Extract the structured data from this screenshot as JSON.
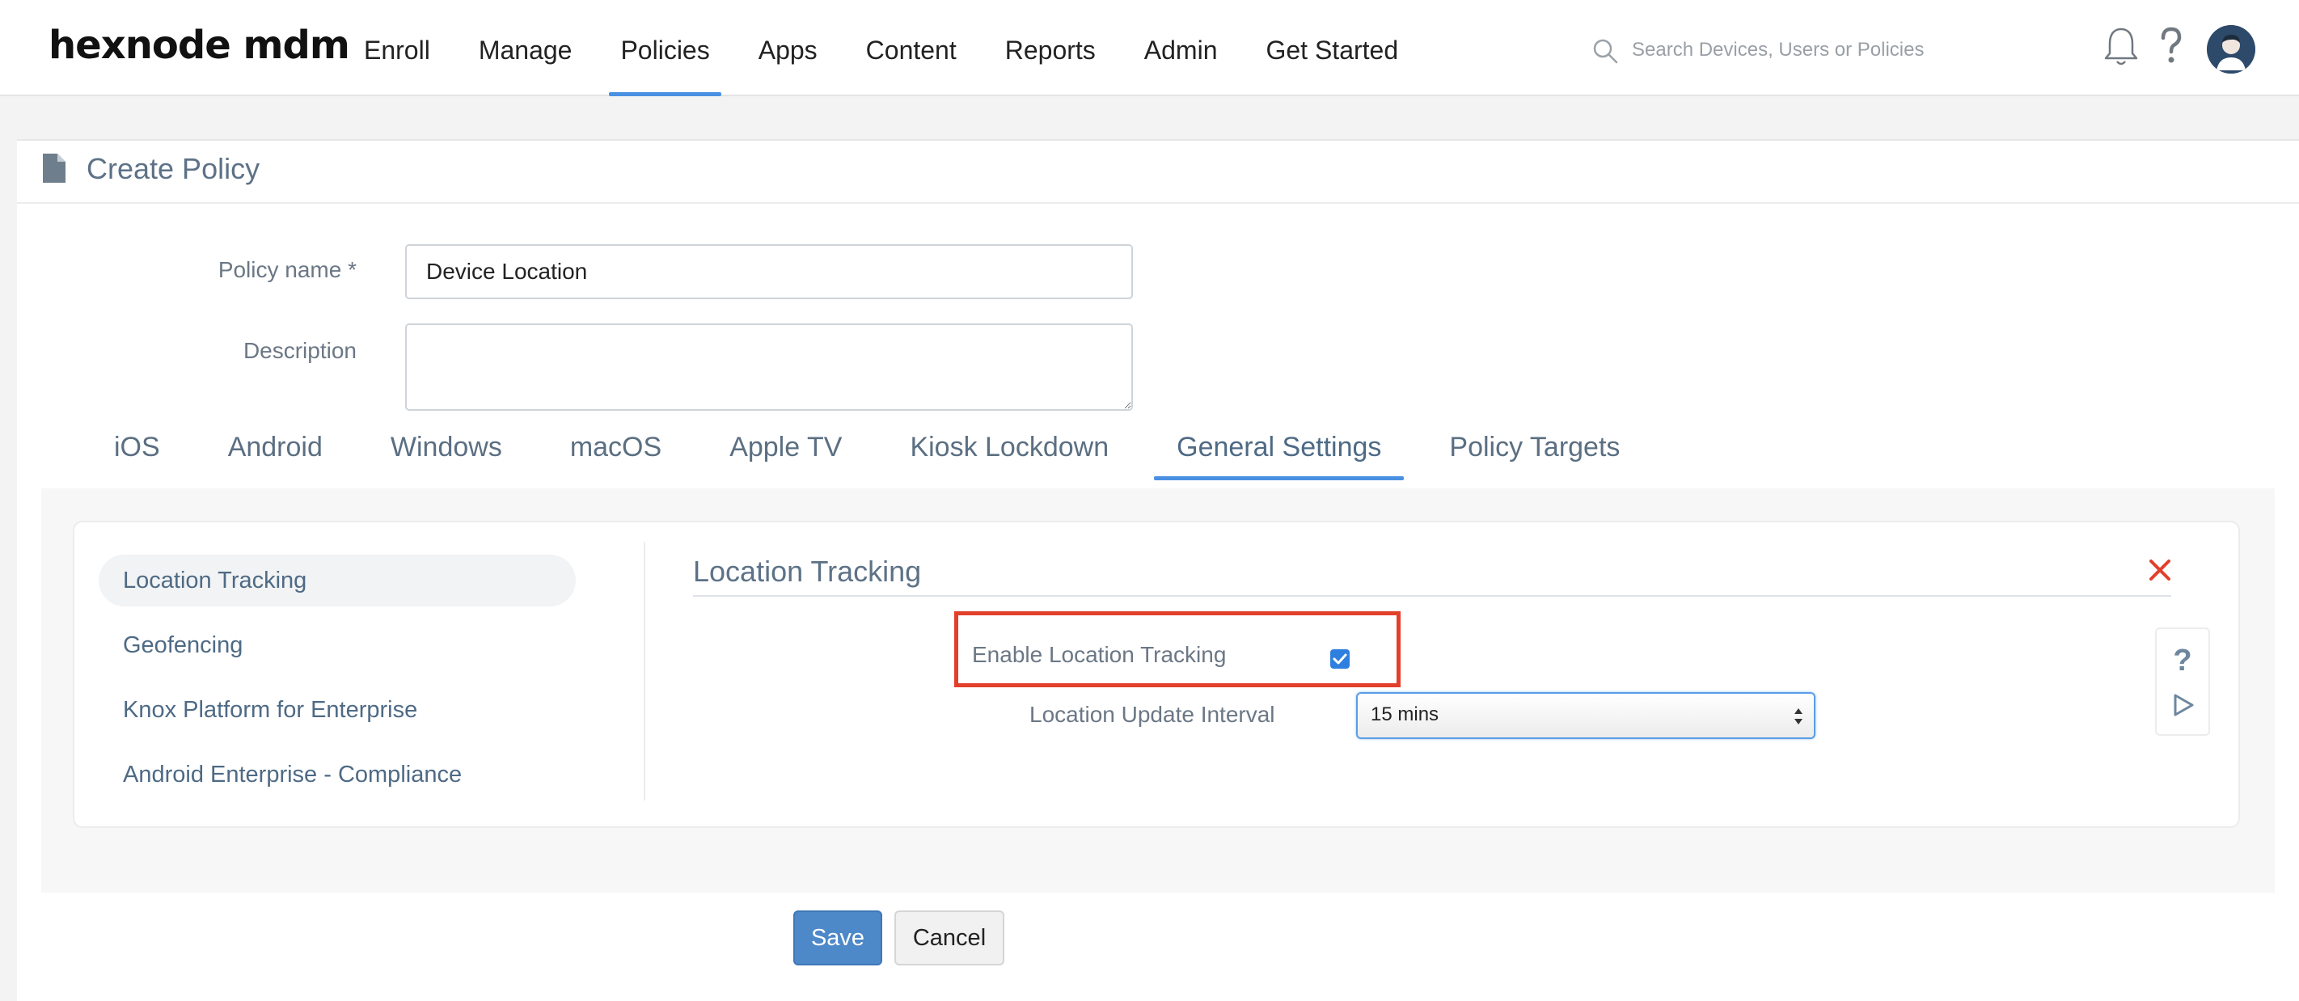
{
  "header": {
    "logo": "hexnode mdm",
    "nav": [
      {
        "label": "Enroll",
        "active": false
      },
      {
        "label": "Manage",
        "active": false
      },
      {
        "label": "Policies",
        "active": true
      },
      {
        "label": "Apps",
        "active": false
      },
      {
        "label": "Content",
        "active": false
      },
      {
        "label": "Reports",
        "active": false
      },
      {
        "label": "Admin",
        "active": false
      },
      {
        "label": "Get Started",
        "active": false
      }
    ],
    "search": {
      "placeholder": "Search Devices, Users or Policies",
      "value": "",
      "icon": "search-icon"
    },
    "icons": [
      "bell-icon",
      "help-icon",
      "user-avatar"
    ]
  },
  "page": {
    "title": "Create Policy",
    "icon": "document-icon"
  },
  "form": {
    "policy_name_label": "Policy name *",
    "policy_name_value": "Device Location",
    "description_label": "Description",
    "description_value": ""
  },
  "tabs": [
    {
      "label": "iOS",
      "active": false
    },
    {
      "label": "Android",
      "active": false
    },
    {
      "label": "Windows",
      "active": false
    },
    {
      "label": "macOS",
      "active": false
    },
    {
      "label": "Apple TV",
      "active": false
    },
    {
      "label": "Kiosk Lockdown",
      "active": false
    },
    {
      "label": "General Settings",
      "active": true
    },
    {
      "label": "Policy Targets",
      "active": false
    }
  ],
  "sidebar": {
    "items": [
      {
        "label": "Location Tracking",
        "active": true
      },
      {
        "label": "Geofencing",
        "active": false
      },
      {
        "label": "Knox Platform for Enterprise",
        "active": false
      },
      {
        "label": "Android Enterprise - Compliance",
        "active": false
      }
    ]
  },
  "section": {
    "title": "Location Tracking",
    "enable_label": "Enable Location Tracking",
    "enable_checked": true,
    "interval_label": "Location Update Interval",
    "interval_value": "15 mins",
    "help_glyph": "?"
  },
  "actions": {
    "save_label": "Save",
    "cancel_label": "Cancel"
  },
  "colors": {
    "accent": "#4a90e2",
    "highlight": "#e2402b",
    "save_button": "#4d88c8",
    "close": "#e2402b"
  }
}
